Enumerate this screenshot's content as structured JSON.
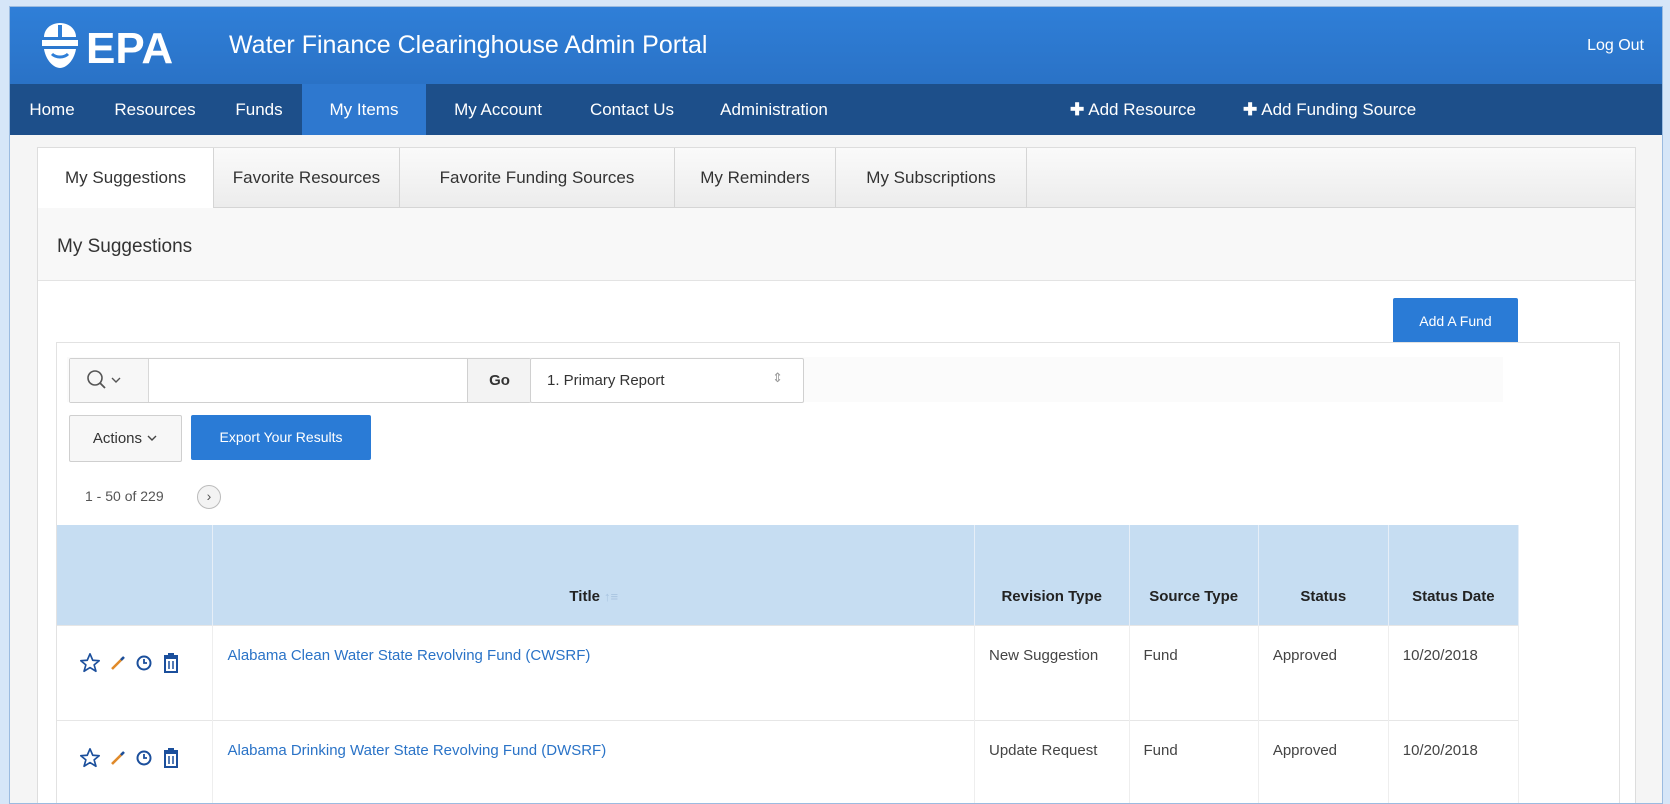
{
  "header": {
    "logo_text": "EPA",
    "app_title": "Water Finance Clearinghouse Admin Portal",
    "logout_label": "Log Out",
    "colors": {
      "header_blue": "#2f7fd8",
      "nav_navy": "#1d4f8a",
      "accent": "#2a7bd6"
    }
  },
  "nav": {
    "items": [
      {
        "label": "Home"
      },
      {
        "label": "Resources"
      },
      {
        "label": "Funds"
      },
      {
        "label": "My Items",
        "active": true
      },
      {
        "label": "My Account"
      },
      {
        "label": "Contact Us"
      },
      {
        "label": "Administration"
      }
    ],
    "add_resource_label": "Add Resource",
    "add_funding_label": "Add Funding Source",
    "add_icon": "plus-icon"
  },
  "subtabs": [
    {
      "label": "My Suggestions",
      "active": true
    },
    {
      "label": "Favorite Resources"
    },
    {
      "label": "Favorite Funding Sources"
    },
    {
      "label": "My Reminders"
    },
    {
      "label": "My Subscriptions"
    }
  ],
  "region": {
    "title": "My Suggestions",
    "add_fund_label": "Add A Fund"
  },
  "search": {
    "value": "",
    "go_label": "Go",
    "icon": "search-icon"
  },
  "report_select": {
    "selected": "1. Primary Report"
  },
  "toolbar": {
    "actions_label": "Actions",
    "export_label": "Export Your Results"
  },
  "pagination": {
    "text": "1 - 50 of 229"
  },
  "table": {
    "columns": {
      "title": "Title",
      "revision_type": "Revision Type",
      "source_type": "Source Type",
      "status": "Status",
      "status_date": "Status Date"
    },
    "rows": [
      {
        "title": "Alabama Clean Water State Revolving Fund (CWSRF)",
        "revision_type": "New Suggestion",
        "source_type": "Fund",
        "status": "Approved",
        "status_date": "10/20/2018"
      },
      {
        "title": "Alabama Drinking Water State Revolving Fund (DWSRF)",
        "revision_type": "Update Request",
        "source_type": "Fund",
        "status": "Approved",
        "status_date": "10/20/2018"
      }
    ],
    "row_icons": [
      "star-icon",
      "pencil-icon",
      "clock-icon",
      "trash-icon"
    ]
  }
}
